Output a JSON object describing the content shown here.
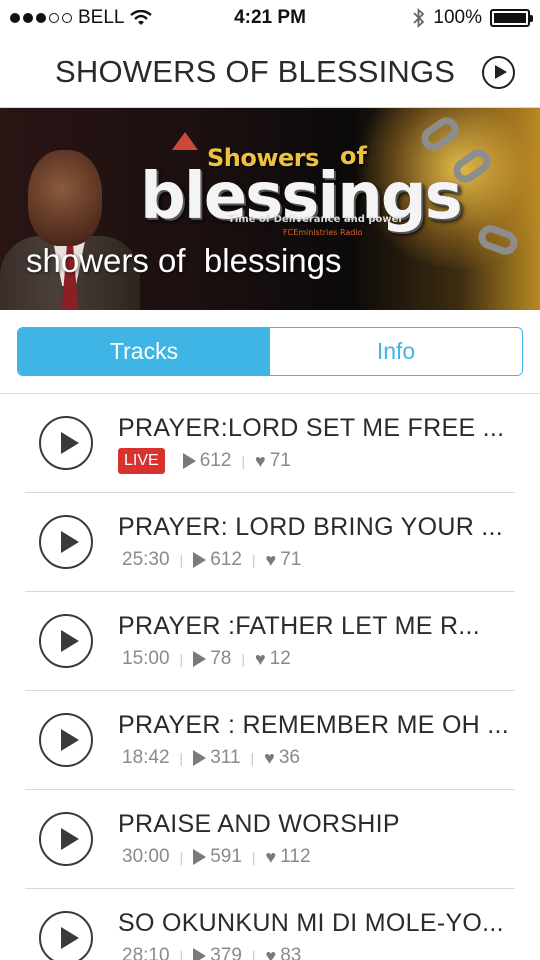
{
  "status_bar": {
    "carrier": "BELL",
    "time": "4:21 PM",
    "battery": "100%",
    "signal_bars_filled": 3,
    "signal_bars_total": 5
  },
  "header": {
    "title": "SHOWERS OF BLESSINGS"
  },
  "banner": {
    "caption": "showers of  blessings",
    "logo_line1": "Showers",
    "logo_of": "of",
    "logo_main": "blessings",
    "logo_tagline": "Time of Deliverance and power",
    "logo_station": "FCEministries Radio"
  },
  "tabs": [
    {
      "label": "Tracks",
      "active": true
    },
    {
      "label": "Info",
      "active": false
    }
  ],
  "colors": {
    "accent": "#3fb5e6",
    "live": "#d8322e"
  },
  "tracks": [
    {
      "title": "PRAYER:LORD SET ME FREE ...",
      "live": true,
      "live_label": "LIVE",
      "duration": "",
      "plays": "612",
      "likes": "71"
    },
    {
      "title": "PRAYER: LORD BRING YOUR ...",
      "live": false,
      "duration": "25:30",
      "plays": "612",
      "likes": "71"
    },
    {
      "title": "PRAYER :FATHER LET ME  R...",
      "live": false,
      "duration": "15:00",
      "plays": "78",
      "likes": "12"
    },
    {
      "title": "PRAYER : REMEMBER ME OH ...",
      "live": false,
      "duration": "18:42",
      "plays": "311",
      "likes": "36"
    },
    {
      "title": "PRAISE AND WORSHIP",
      "live": false,
      "duration": "30:00",
      "plays": "591",
      "likes": "112"
    },
    {
      "title": "SO OKUNKUN MI DI MOLE-YO...",
      "live": false,
      "duration": "28:10",
      "plays": "379",
      "likes": "83"
    }
  ]
}
